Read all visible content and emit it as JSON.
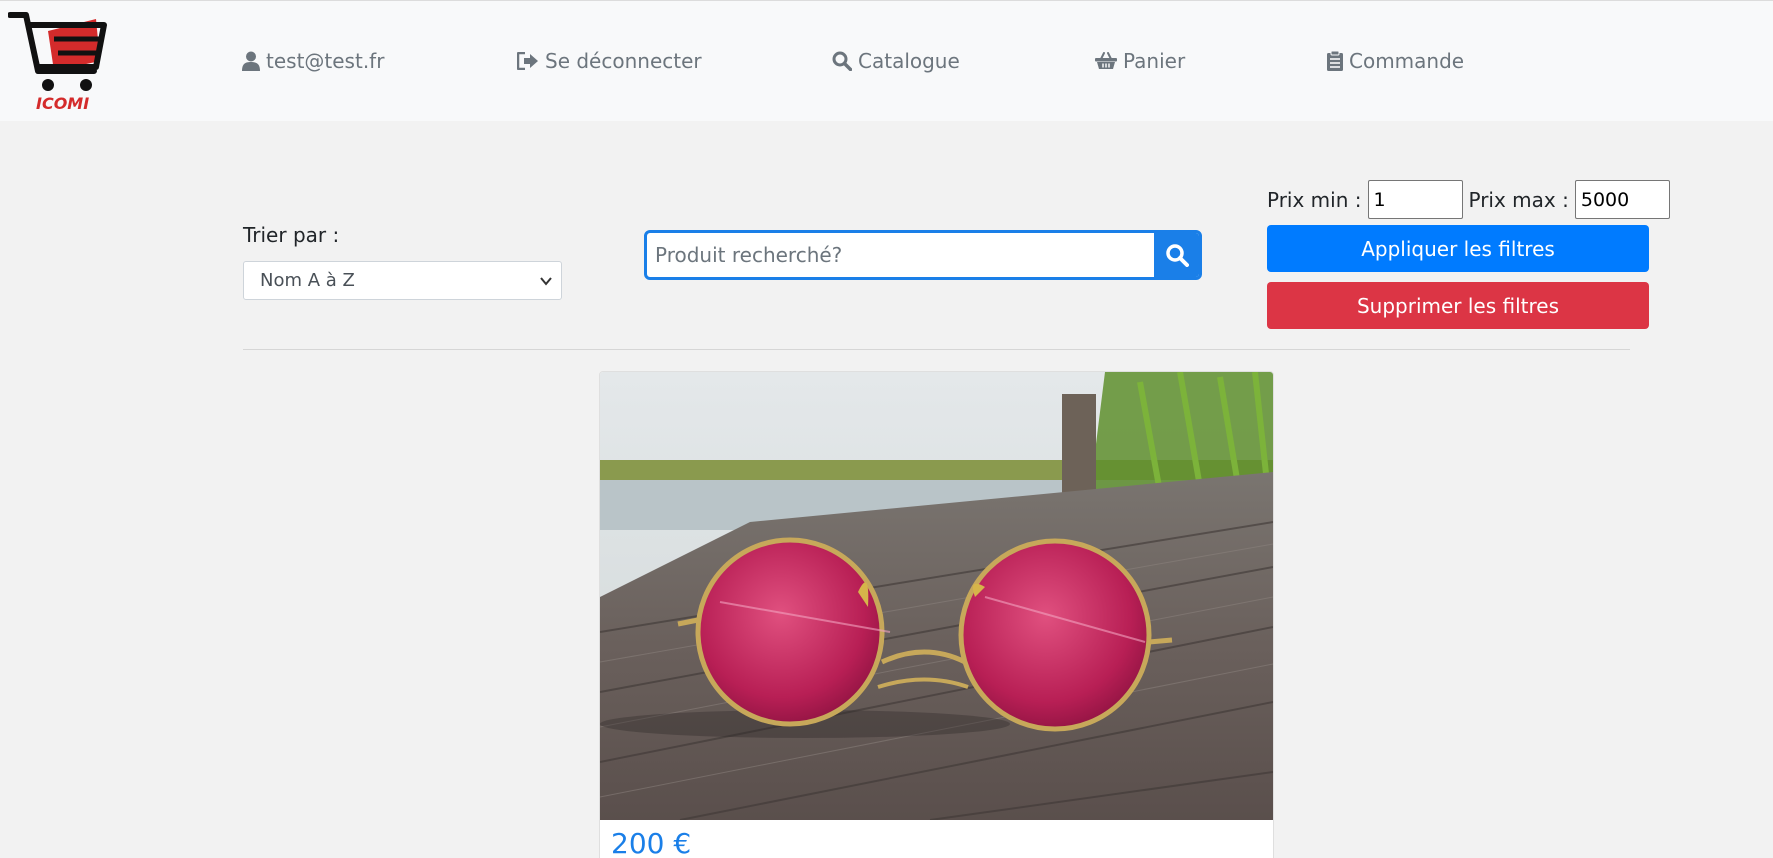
{
  "brand": {
    "logo_text": "ICOMI"
  },
  "nav": {
    "user": "test@test.fr",
    "logout": "Se déconnecter",
    "catalog": "Catalogue",
    "cart": "Panier",
    "order": "Commande"
  },
  "filters": {
    "sort_label": "Trier par :",
    "sort_selected": "Nom A à Z",
    "search_placeholder": "Produit recherché?",
    "price_min_label": "Prix min :",
    "price_min_value": "1",
    "price_max_label": "Prix max :",
    "price_max_value": "5000",
    "apply_label": "Appliquer les filtres",
    "clear_label": "Supprimer les filtres"
  },
  "products": [
    {
      "price": "200 €",
      "image": "pink-round-sunglasses-on-wooden-dock-photo"
    }
  ],
  "colors": {
    "primary": "#007bff",
    "search_accent": "#1a7fe8",
    "danger": "#dc3545",
    "nav_text": "#6c757d",
    "logo_red": "#d42b2b"
  }
}
